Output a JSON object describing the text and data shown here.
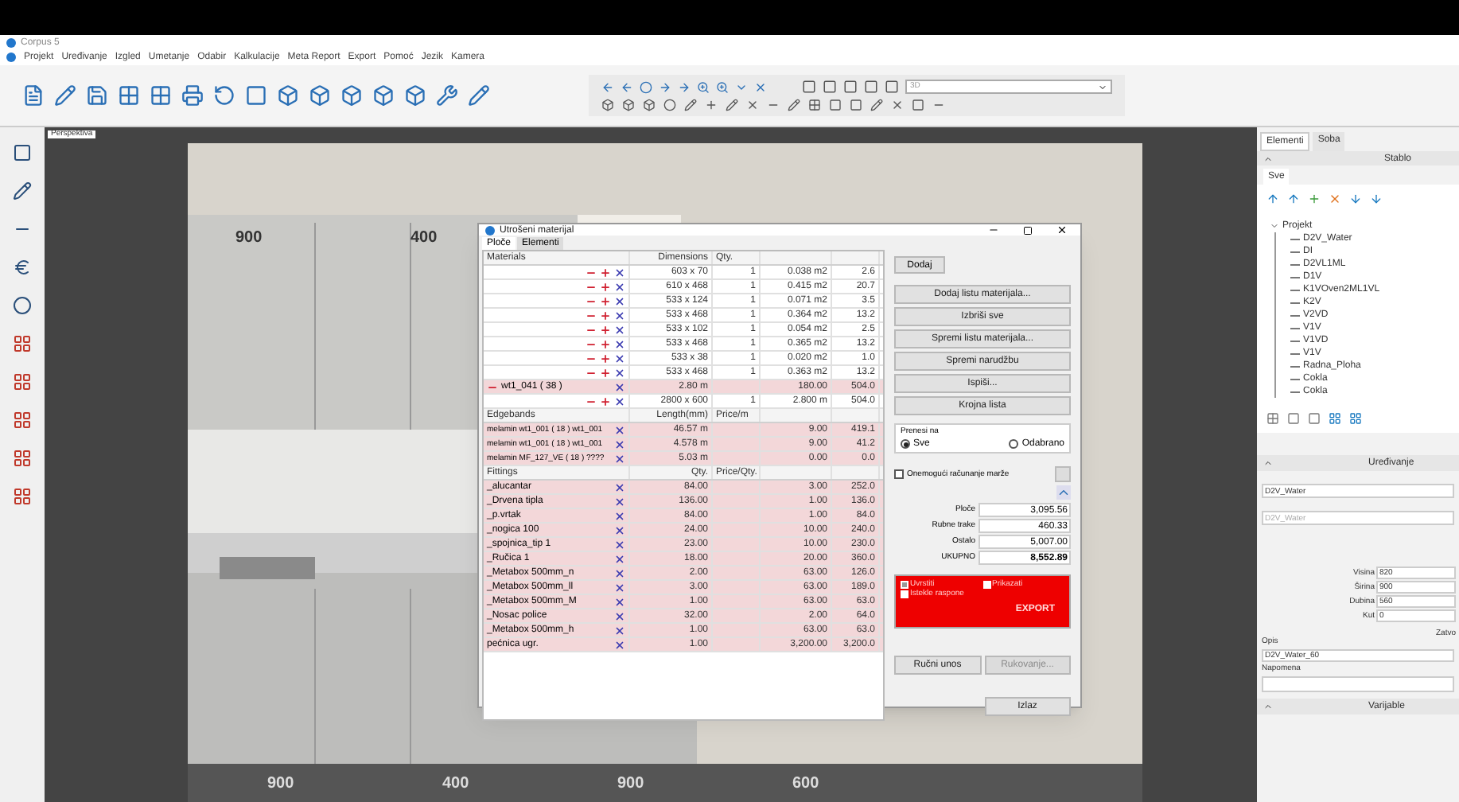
{
  "app": {
    "title": "Corpus 5"
  },
  "menu": [
    "Projekt",
    "Uređivanje",
    "Izgled",
    "Umetanje",
    "Odabir",
    "Kalkulacije",
    "Meta Report",
    "Export",
    "Pomoć",
    "Jezik",
    "Kamera"
  ],
  "toolbar": {
    "view_select": "3D"
  },
  "canvas": {
    "view_label": "Perspektiva",
    "top_dimensions": [
      "900",
      "400"
    ],
    "bottom_dimensions": [
      "900",
      "400",
      "900",
      "600"
    ]
  },
  "dialog": {
    "title": "Utrošeni materijal",
    "tabs": [
      {
        "label": "Ploče",
        "selected": true
      },
      {
        "label": "Elementi",
        "selected": false
      }
    ],
    "materials": {
      "headers": [
        "Materials",
        "Dimensions",
        "Qty."
      ],
      "rows": [
        {
          "kind": "part",
          "name": "",
          "dim": "603 x 70",
          "qty": "1",
          "area": "0.038 m2",
          "price": "2.6"
        },
        {
          "kind": "part",
          "name": "",
          "dim": "610 x 468",
          "qty": "1",
          "area": "0.415 m2",
          "price": "20.7"
        },
        {
          "kind": "part",
          "name": "",
          "dim": "533 x 124",
          "qty": "1",
          "area": "0.071 m2",
          "price": "3.5"
        },
        {
          "kind": "part",
          "name": "",
          "dim": "533 x 468",
          "qty": "1",
          "area": "0.364 m2",
          "price": "13.2"
        },
        {
          "kind": "part",
          "name": "",
          "dim": "533 x 102",
          "qty": "1",
          "area": "0.054 m2",
          "price": "2.5"
        },
        {
          "kind": "part",
          "name": "",
          "dim": "533 x 468",
          "qty": "1",
          "area": "0.365 m2",
          "price": "13.2"
        },
        {
          "kind": "part",
          "name": "",
          "dim": "533 x 38",
          "qty": "1",
          "area": "0.020 m2",
          "price": "1.0"
        },
        {
          "kind": "part",
          "name": "",
          "dim": "533 x 468",
          "qty": "1",
          "area": "0.363 m2",
          "price": "13.2"
        },
        {
          "kind": "material",
          "name": "wt1_041 ( 38 )",
          "dim": "2.80 m",
          "qty": "",
          "area": "180.00",
          "price": "504.0"
        },
        {
          "kind": "part",
          "name": "",
          "dim": "2800 x 600",
          "qty": "1",
          "area": "2.800 m",
          "price": "504.0"
        }
      ]
    },
    "edgebands": {
      "headers": [
        "Edgebands",
        "Length(mm)",
        "Price/m"
      ],
      "rows": [
        {
          "name": "melamin wt1_001 ( 18 ) wt1_001",
          "length": "46.57 m",
          "price": "9.00",
          "total": "419.1"
        },
        {
          "name": "melamin wt1_001 ( 18 ) wt1_001",
          "length": "4.578 m",
          "price": "9.00",
          "total": "41.2"
        },
        {
          "name": "melamin MF_127_VE ( 18 ) ????",
          "length": "5.03 m",
          "price": "0.00",
          "total": "0.0"
        }
      ]
    },
    "fittings": {
      "headers": [
        "Fittings",
        "Qty.",
        "Price/Qty."
      ],
      "rows": [
        {
          "name": "_alucantar",
          "qty": "84.00",
          "price": "3.00",
          "total": "252.0"
        },
        {
          "name": "_Drvena tipla",
          "qty": "136.00",
          "price": "1.00",
          "total": "136.0"
        },
        {
          "name": "_p.vrtak",
          "qty": "84.00",
          "price": "1.00",
          "total": "84.0"
        },
        {
          "name": "_nogica 100",
          "qty": "24.00",
          "price": "10.00",
          "total": "240.0"
        },
        {
          "name": "_spojnica_tip 1",
          "qty": "23.00",
          "price": "10.00",
          "total": "230.0"
        },
        {
          "name": "_Ručica 1",
          "qty": "18.00",
          "price": "20.00",
          "total": "360.0"
        },
        {
          "name": "_Metabox 500mm_n",
          "qty": "2.00",
          "price": "63.00",
          "total": "126.0"
        },
        {
          "name": "_Metabox 500mm_ll",
          "qty": "3.00",
          "price": "63.00",
          "total": "189.0"
        },
        {
          "name": "_Metabox 500mm_M",
          "qty": "1.00",
          "price": "63.00",
          "total": "63.0"
        },
        {
          "name": "_Nosac police",
          "qty": "32.00",
          "price": "2.00",
          "total": "64.0"
        },
        {
          "name": "_Metabox 500mm_h",
          "qty": "1.00",
          "price": "63.00",
          "total": "63.0"
        },
        {
          "name": "pećnica ugr.",
          "qty": "1.00",
          "price": "3,200.00",
          "total": "3,200.0"
        }
      ]
    },
    "buttons": [
      "Dodaj",
      "Dodaj listu materijala...",
      "Izbriši sve",
      "Spremi listu materijala...",
      "Spremi narudžbu",
      "Ispiši...",
      "Krojna lista"
    ],
    "transfer": {
      "label": "Prenesi na",
      "options": [
        {
          "label": "Sve",
          "selected": true
        },
        {
          "label": "Odabrano",
          "selected": false
        }
      ]
    },
    "margin_checkbox": {
      "label": "Onemogući računanje marže",
      "checked": false
    },
    "totals": [
      {
        "label": "Ploče",
        "value": "3,095.56",
        "bold": false
      },
      {
        "label": "Rubne trake",
        "value": "460.33",
        "bold": false
      },
      {
        "label": "Ostalo",
        "value": "5,007.00",
        "bold": false
      },
      {
        "label": "UKUPNO",
        "value": "8,552.89",
        "bold": true
      }
    ],
    "export": {
      "options": [
        {
          "label": "Uvrstiti",
          "checked": true
        },
        {
          "label": "Prikazati",
          "checked": false
        },
        {
          "label": "Istekle raspone",
          "checked": false
        }
      ],
      "button": "EXPORT"
    },
    "bottom_buttons": [
      {
        "label": "Ručni unos",
        "disabled": false
      },
      {
        "label": "Rukovanje...",
        "disabled": true
      },
      {
        "label": "Izlaz",
        "disabled": false
      }
    ]
  },
  "right_panel": {
    "tabs": [
      {
        "label": "Elementi",
        "selected": true
      },
      {
        "label": "Soba",
        "selected": false
      }
    ],
    "tree_header": "Stablo",
    "filter_tab": "Sve",
    "tree": [
      {
        "label": "Projekt",
        "expanded": true,
        "children": [
          {
            "label": "D2V_Water"
          },
          {
            "label": "DI"
          },
          {
            "label": "D2VL1ML"
          },
          {
            "label": "D1V"
          },
          {
            "label": "K1VOven2ML1VL"
          },
          {
            "label": "K2V"
          },
          {
            "label": "V2VD"
          },
          {
            "label": "V1V"
          },
          {
            "label": "V1VD"
          },
          {
            "label": "V1V"
          },
          {
            "label": "Radna_Ploha"
          },
          {
            "label": "Cokla"
          },
          {
            "label": "Cokla"
          }
        ]
      }
    ],
    "edit_header": "Uređivanje",
    "name_fields": [
      "D2V_Water",
      "D2V_Water"
    ],
    "dims": [
      {
        "label": "Visina",
        "value": "820"
      },
      {
        "label": "Širina",
        "value": "900"
      },
      {
        "label": "Dubina",
        "value": "560"
      },
      {
        "label": "Kut",
        "value": "0"
      }
    ],
    "cut_label": "Zatvo",
    "description_label": "Opis",
    "description": "D2V_Water_60",
    "note_label": "Napomena",
    "variables_header": "Varijable"
  }
}
